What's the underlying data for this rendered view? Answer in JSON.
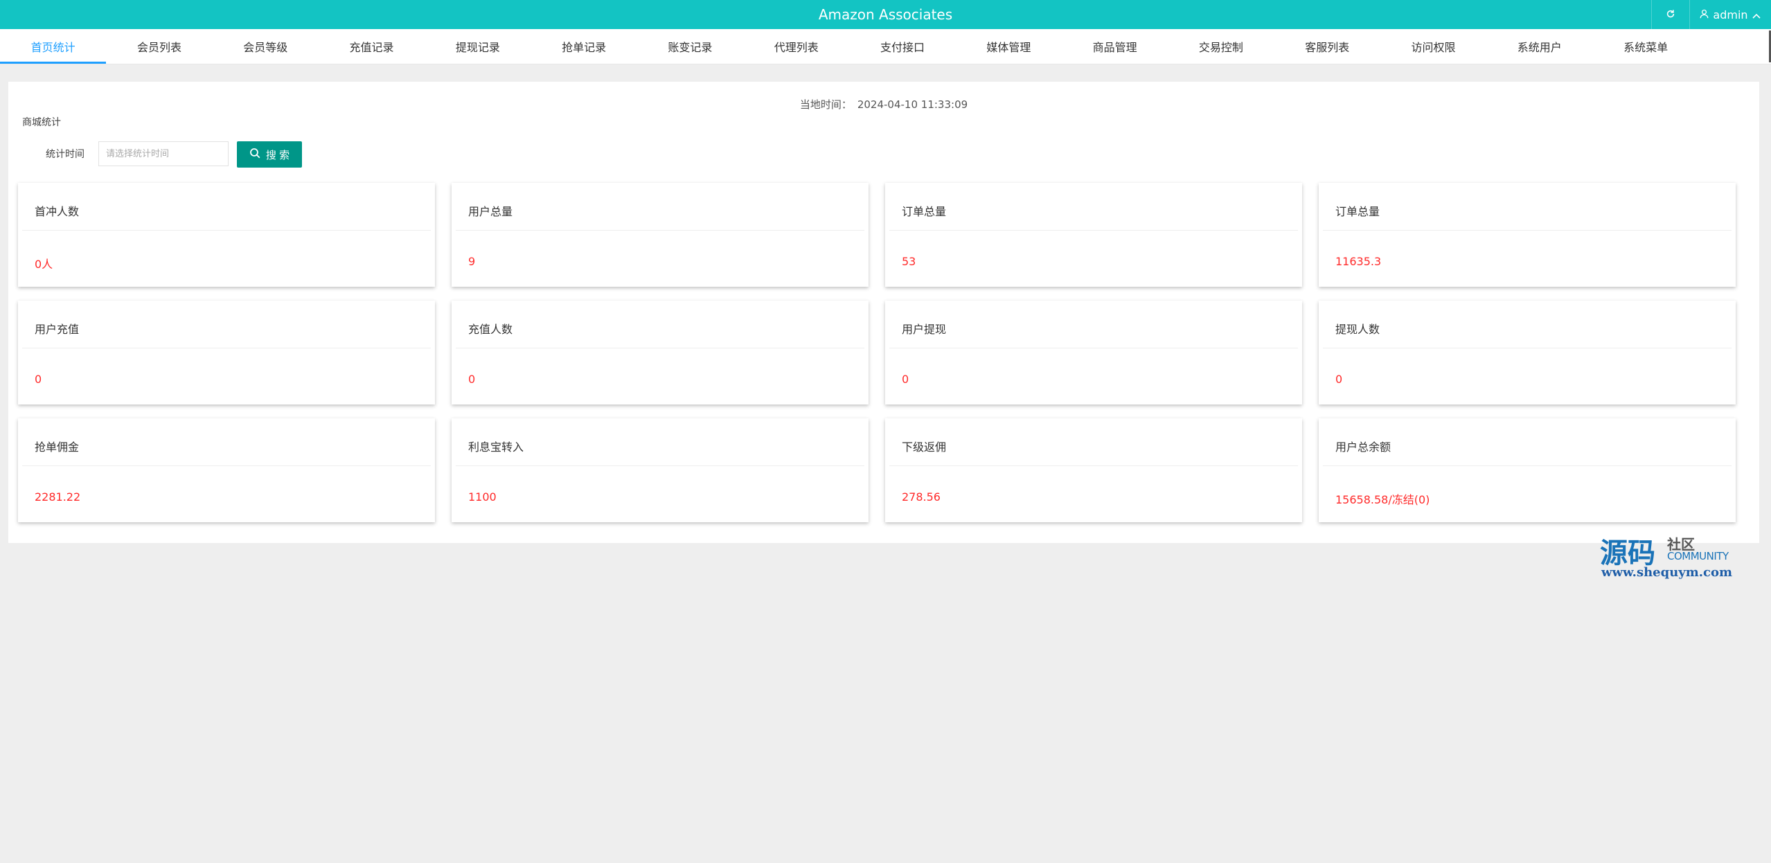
{
  "header": {
    "title": "Amazon Associates",
    "refresh_icon": "refresh-icon",
    "user_icon": "user-icon",
    "username": "admin",
    "caret_icon": "chevron-up-icon",
    "background": "#13c4c3"
  },
  "nav": {
    "active_color": "#1e9fff",
    "tabs": [
      {
        "label": "首页统计",
        "active": true
      },
      {
        "label": "会员列表"
      },
      {
        "label": "会员等级"
      },
      {
        "label": "充值记录"
      },
      {
        "label": "提现记录"
      },
      {
        "label": "抢单记录"
      },
      {
        "label": "账变记录"
      },
      {
        "label": "代理列表"
      },
      {
        "label": "支付接口"
      },
      {
        "label": "媒体管理"
      },
      {
        "label": "商品管理"
      },
      {
        "label": "交易控制"
      },
      {
        "label": "客服列表"
      },
      {
        "label": "访问权限"
      },
      {
        "label": "系统用户"
      },
      {
        "label": "系统菜单"
      }
    ]
  },
  "main": {
    "time_label": "当地时间：",
    "time_value": "2024-04-10 11:33:09",
    "section_label": "商城统计",
    "search": {
      "label": "统计时间",
      "placeholder": "请选择统计时间",
      "button_label": "搜 索",
      "button_icon": "search-icon",
      "button_color": "#009688"
    },
    "value_color": "#ff2a2a",
    "cards": [
      {
        "title": "首冲人数",
        "value": "0人"
      },
      {
        "title": "用户总量",
        "value": "9"
      },
      {
        "title": "订单总量",
        "value": "53"
      },
      {
        "title": "订单总量",
        "value": "11635.3"
      },
      {
        "title": "用户充值",
        "value": "0"
      },
      {
        "title": "充值人数",
        "value": "0"
      },
      {
        "title": "用户提现",
        "value": "0"
      },
      {
        "title": "提现人数",
        "value": "0"
      },
      {
        "title": "抢单佣金",
        "value": "2281.22"
      },
      {
        "title": "利息宝转入",
        "value": "1100"
      },
      {
        "title": "下级返佣",
        "value": "278.56"
      },
      {
        "title": "用户总余额",
        "value": "15658.58/冻结(0)"
      }
    ]
  },
  "watermark": {
    "main": "源码",
    "side_top": "社区",
    "side_bottom": "COMMUNITY",
    "url": "www.shequym.com"
  }
}
